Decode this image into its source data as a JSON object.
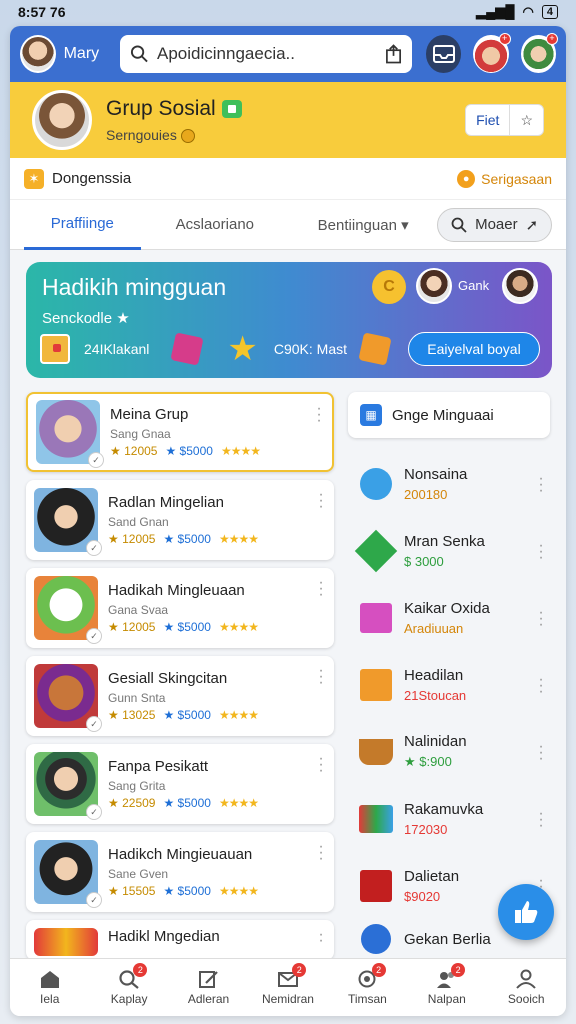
{
  "status_bar": {
    "time": "8:57 76",
    "battery": "4"
  },
  "topbar": {
    "user_name": "Mary",
    "search_value": "Apoidicinngaecia..",
    "share_icon": "share-icon",
    "colors": {
      "bar": "#3b6fd0"
    }
  },
  "group": {
    "title": "Grup Sosial",
    "subtitle": "Serngouies",
    "btn_primary": "Fiet",
    "btn_secondary": "☆",
    "color": "#f8cc3c"
  },
  "category": {
    "label": "Dongenssia",
    "right_label": "Serigasaan"
  },
  "tabs": [
    {
      "label": "Praffiinge",
      "active": true
    },
    {
      "label": "Acslaoriano",
      "active": false
    },
    {
      "label": "Bentiinguan ▾",
      "active": false
    }
  ],
  "more_btn": "Moaer",
  "banner": {
    "title": "Hadikih mingguan",
    "subtitle": "Senckodle ★",
    "user_name": "Gank",
    "coin_label": "C",
    "stat1": "24IKlakanl",
    "stat2": "C90K: Mast",
    "button": "Eaiyelval boyal"
  },
  "left_cards": [
    {
      "title": "Meina Grup",
      "sub": "Sang Gnaa",
      "n1": "★ 12005",
      "n2": "★ $5000",
      "stars": "★★★★"
    },
    {
      "title": "Radlan Mingelian",
      "sub": "Sand Gnan",
      "n1": "★ 12005",
      "n2": "★ $5000",
      "stars": "★★★★"
    },
    {
      "title": "Hadikah Mingleuaan",
      "sub": "Gana Svaa",
      "n1": "★ 12005",
      "n2": "★ $5000",
      "stars": "★★★★"
    },
    {
      "title": "Gesiall Skingcitan",
      "sub": "Gunn Snta",
      "n1": "★ 13025",
      "n2": "★ $5000",
      "stars": "★★★★"
    },
    {
      "title": "Fanpa Pesikatt",
      "sub": "Sang Grita",
      "n1": "★ 22509",
      "n2": "★ $5000",
      "stars": "★★★★"
    },
    {
      "title": "Hadikch Mingieuauan",
      "sub": "Sane Gven",
      "n1": "★ 15505",
      "n2": "★ $5000",
      "stars": "★★★★"
    },
    {
      "title": "Hadikl Mngedian",
      "sub": "",
      "n1": "",
      "n2": "",
      "stars": ""
    }
  ],
  "right_panel": {
    "header": "Gnge Minguaai",
    "items": [
      {
        "name": "Nonsaina",
        "value": "200180",
        "color": "#d4860a"
      },
      {
        "name": "Mran Senka",
        "value": "$ 3000",
        "color": "#2e9e3e"
      },
      {
        "name": "Kaikar Oxida",
        "value": "Aradiuuan",
        "color": "#d4860a"
      },
      {
        "name": "Headilan",
        "value": "21Stoucan",
        "color": "#e53935"
      },
      {
        "name": "Nalinidan",
        "value": "★ $:900",
        "color": "#2e9e3e"
      },
      {
        "name": "Rakamuvka",
        "value": "172030",
        "color": "#e53935"
      },
      {
        "name": "Dalietan",
        "value": "$9020",
        "color": "#e53935"
      },
      {
        "name": "Gekan Berlia",
        "value": "",
        "color": "#e53935"
      }
    ]
  },
  "bottom_nav": [
    {
      "label": "Iela",
      "icon": "home-icon",
      "badge": ""
    },
    {
      "label": "Kaplay",
      "icon": "search-icon",
      "badge": "2"
    },
    {
      "label": "Adleran",
      "icon": "edit-icon",
      "badge": ""
    },
    {
      "label": "Nemidran",
      "icon": "mail-icon",
      "badge": "2"
    },
    {
      "label": "Timsan",
      "icon": "refresh-icon",
      "badge": "2"
    },
    {
      "label": "Nalpan",
      "icon": "people-icon",
      "badge": "2"
    },
    {
      "label": "Sooich",
      "icon": "profile-icon",
      "badge": ""
    }
  ]
}
